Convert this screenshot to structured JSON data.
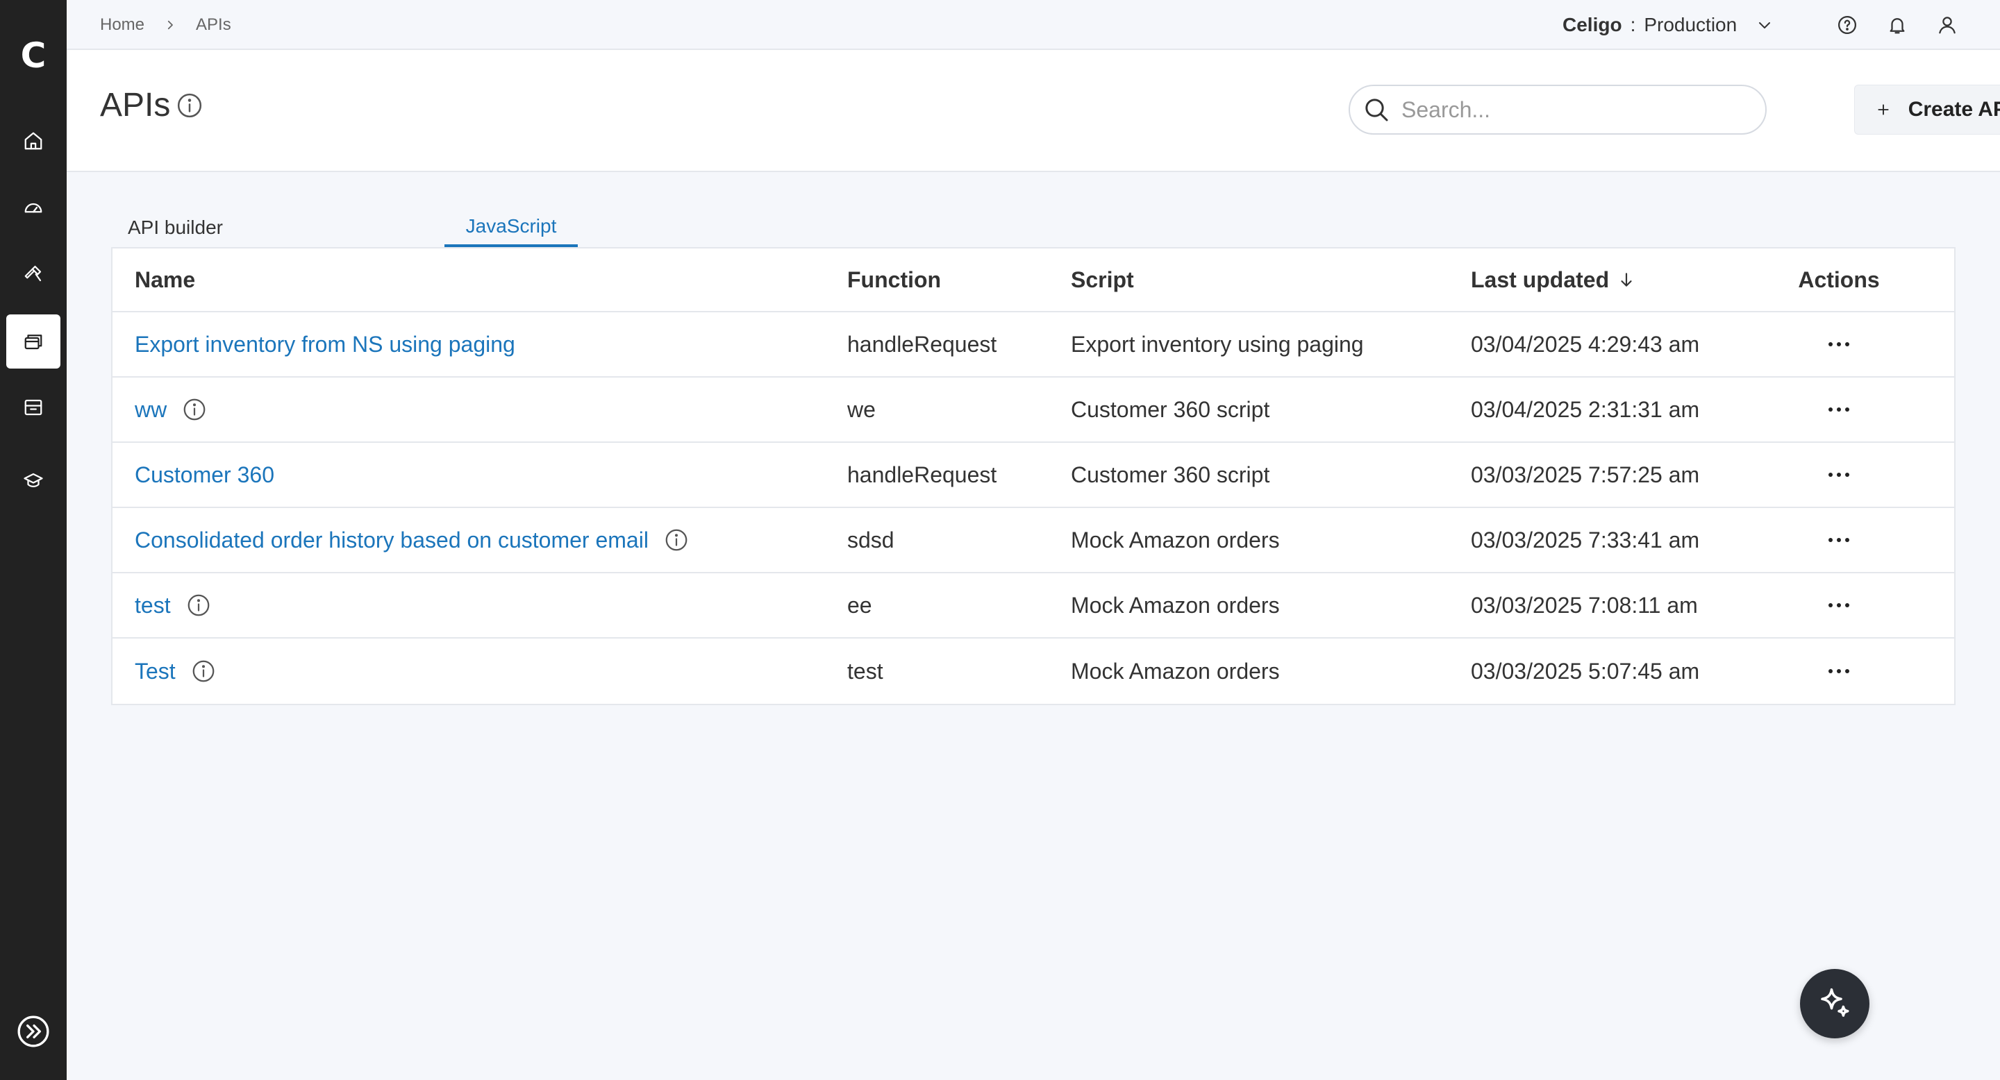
{
  "sidebar": {
    "logo": "C",
    "items": [
      {
        "icon": "home-icon"
      },
      {
        "icon": "dashboard-icon"
      },
      {
        "icon": "tools-icon"
      },
      {
        "icon": "api-icon",
        "active": true
      },
      {
        "icon": "marketplace-icon"
      },
      {
        "icon": "academy-icon"
      }
    ],
    "expand_icon": "expand-icon"
  },
  "breadcrumb": {
    "home": "Home",
    "current": "APIs"
  },
  "account": {
    "org": "Celigo",
    "separator": ":",
    "environment": "Production"
  },
  "header": {
    "title": "APIs",
    "search_placeholder": "Search...",
    "create_label": "Create API"
  },
  "tabs": [
    {
      "label": "API builder",
      "active": false
    },
    {
      "label": "JavaScript",
      "active": true
    }
  ],
  "table": {
    "columns": {
      "name": "Name",
      "function": "Function",
      "script": "Script",
      "last_updated": "Last updated",
      "actions": "Actions"
    },
    "rows": [
      {
        "name": "Export inventory from NS using paging",
        "info": false,
        "function": "handleRequest",
        "script": "Export inventory using paging",
        "last_updated": "03/04/2025 4:29:43 am"
      },
      {
        "name": "ww",
        "info": true,
        "function": "we",
        "script": "Customer 360 script",
        "last_updated": "03/04/2025 2:31:31 am"
      },
      {
        "name": "Customer 360",
        "info": false,
        "function": "handleRequest",
        "script": "Customer 360 script",
        "last_updated": "03/03/2025 7:57:25 am"
      },
      {
        "name": "Consolidated order history based on customer email",
        "info": true,
        "function": "sdsd",
        "script": "Mock Amazon orders",
        "last_updated": "03/03/2025 7:33:41 am"
      },
      {
        "name": "test",
        "info": true,
        "function": "ee",
        "script": "Mock Amazon orders",
        "last_updated": "03/03/2025 7:08:11 am"
      },
      {
        "name": "Test",
        "info": true,
        "function": "test",
        "script": "Mock Amazon orders",
        "last_updated": "03/03/2025 5:07:45 am"
      }
    ]
  },
  "colors": {
    "accent": "#1b75bb",
    "sidebar": "#222222",
    "fab": "#2b2f36"
  }
}
